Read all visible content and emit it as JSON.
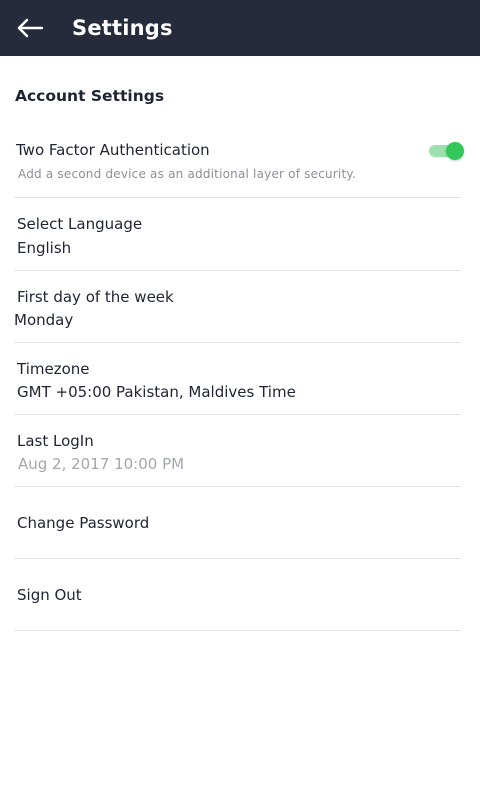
{
  "header": {
    "title": "Settings",
    "back_icon": "arrow-left-icon",
    "background": "#262b3b"
  },
  "section": {
    "heading": "Account Settings"
  },
  "two_factor": {
    "label": "Two Factor Authentication",
    "description": "Add a second device as an additional layer of security.",
    "enabled": true,
    "toggle_color": "#34c759"
  },
  "language": {
    "label": "Select Language",
    "value": "English"
  },
  "first_day": {
    "label": "First day of the week",
    "value": "Monday"
  },
  "timezone": {
    "label": "Timezone",
    "value": "GMT +05:00 Pakistan, Maldives Time"
  },
  "last_login": {
    "label": "Last LogIn",
    "value": "Aug 2, 2017 10:00 PM"
  },
  "change_password": {
    "label": "Change Password"
  },
  "sign_out": {
    "label": "Sign Out"
  }
}
